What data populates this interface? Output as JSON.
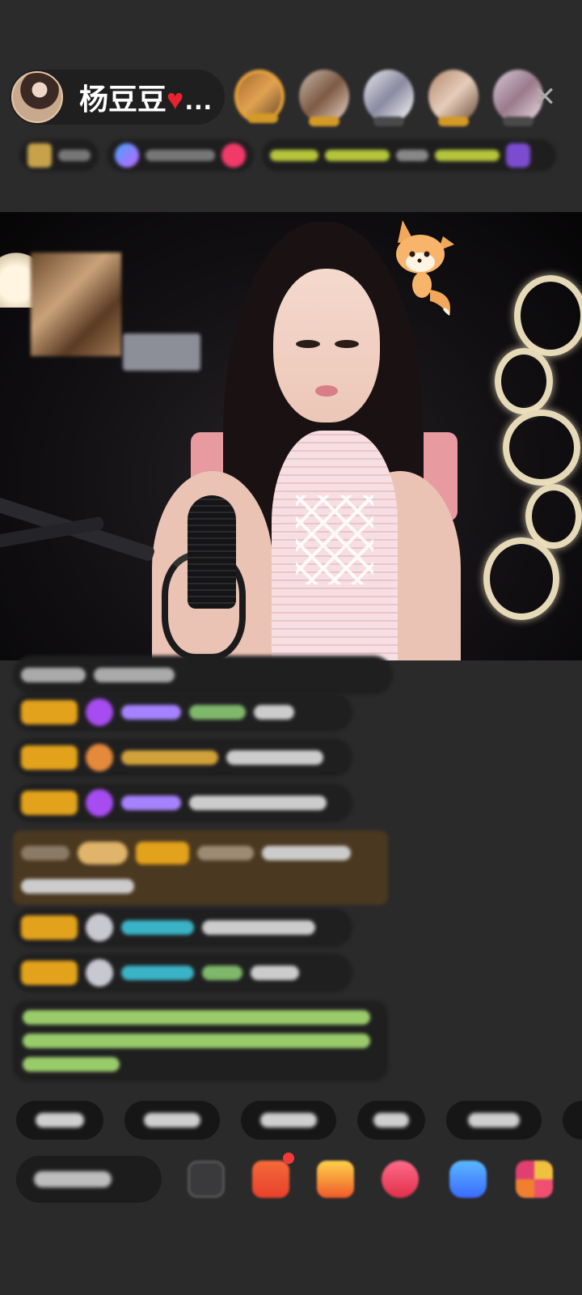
{
  "host": {
    "name": "杨豆豆",
    "heart": "♥",
    "ellipsis": "…"
  },
  "header": {
    "close_icon": "close-icon"
  },
  "viewers": [
    {
      "name": "viewer-avatar",
      "bg": "linear-gradient(135deg,#a56a2f,#e1a351,#6c4a2c)"
    },
    {
      "name": "viewer-avatar",
      "bg": "linear-gradient(135deg,#c9b7a8,#7d5a45,#efd9cc)"
    },
    {
      "name": "viewer-avatar",
      "bg": "linear-gradient(135deg,#e9e9ef,#8a8aa1,#ffffff)"
    },
    {
      "name": "viewer-avatar",
      "bg": "linear-gradient(135deg,#b5876a,#e6cdbb,#6a4a36)"
    },
    {
      "name": "viewer-avatar",
      "bg": "linear-gradient(135deg,#d8c9d9,#9a7a8a,#f0e0ea)"
    }
  ],
  "colors": {
    "accent_gold": "#e3a21b",
    "purple_gem": "#a64cf0",
    "name_purple": "#a782ff",
    "name_cyan": "#3bb3c6",
    "chat_green": "#9acb6a",
    "gold_banner": "#4a3820"
  },
  "bottom_bar": {
    "icons": [
      "emoji-icon",
      "gift-box-icon",
      "treasure-icon",
      "heart-gift-icon",
      "game-controller-icon",
      "more-apps-icon"
    ]
  }
}
